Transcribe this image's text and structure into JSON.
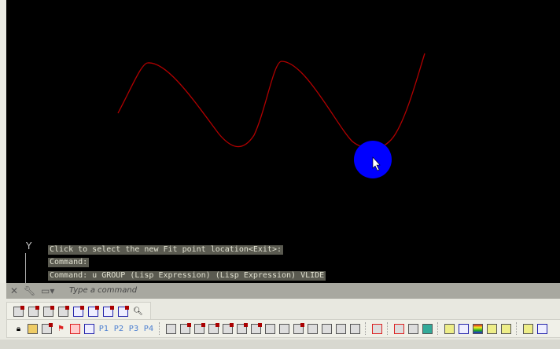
{
  "command_history": [
    "Click to select the new Fit point location<Exit>:",
    "Command:",
    "Command: u GROUP (Lisp Expression) (Lisp Expression) VLIDE"
  ],
  "command_line": {
    "placeholder": "Type a command"
  },
  "ucs_axis_label": "Y",
  "colors": {
    "canvas": "#000000",
    "spline": "#b00000",
    "cursor_highlight": "#0000ff"
  },
  "toolbar1": {
    "icons": [
      "pan-up-icon",
      "pan-down-icon",
      "pan-right-icon",
      "pan-left-icon",
      "view-up-icon",
      "view-down-icon",
      "view-right-icon",
      "view-left-icon",
      "zoom-icon"
    ]
  },
  "toolbar2": {
    "labels": [
      "P1",
      "P2",
      "P3",
      "P4"
    ]
  }
}
